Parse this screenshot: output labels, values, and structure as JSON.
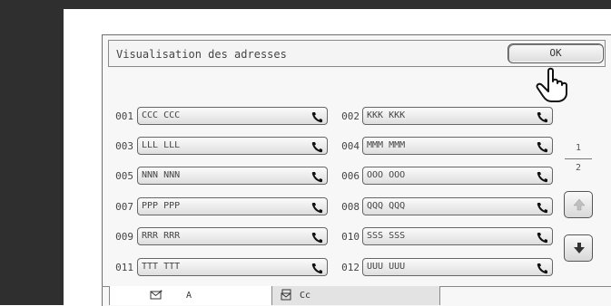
{
  "header": {
    "title": "Visualisation des adresses",
    "ok_label": "OK"
  },
  "entries": [
    {
      "number": "001",
      "name": "CCC CCC"
    },
    {
      "number": "002",
      "name": "KKK KKK"
    },
    {
      "number": "003",
      "name": "LLL LLL"
    },
    {
      "number": "004",
      "name": "MMM MMM"
    },
    {
      "number": "005",
      "name": "NNN NNN"
    },
    {
      "number": "006",
      "name": "OOO OOO"
    },
    {
      "number": "007",
      "name": "PPP PPP"
    },
    {
      "number": "008",
      "name": "QQQ QQQ"
    },
    {
      "number": "009",
      "name": "RRR RRR"
    },
    {
      "number": "010",
      "name": "SSS SSS"
    },
    {
      "number": "011",
      "name": "TTT TTT"
    },
    {
      "number": "012",
      "name": "UUU UUU"
    }
  ],
  "pagination": {
    "current": "1",
    "total": "2"
  },
  "tabs": {
    "to_label": "A",
    "cc_label": "Cc"
  },
  "icons": {
    "entry": "phone-icon",
    "up": "arrow-up-icon",
    "down": "arrow-down-icon",
    "pointer": "hand-pointer-icon"
  }
}
